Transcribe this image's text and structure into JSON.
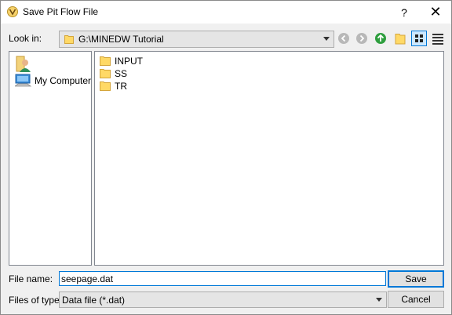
{
  "window": {
    "title": "Save Pit Flow File",
    "help_glyph": "?",
    "close_glyph": "✕"
  },
  "lookin": {
    "label": "Look in:",
    "path": "G:\\MINEDW Tutorial"
  },
  "toolbar": {
    "icons": [
      "back-icon",
      "forward-icon",
      "up-folder-icon",
      "new-folder-icon",
      "list-view-icon",
      "detail-view-icon"
    ]
  },
  "places": {
    "items": [
      {
        "label": "",
        "icon": "user-icon"
      },
      {
        "label": "My Computer",
        "icon": "computer-icon"
      }
    ]
  },
  "files": [
    {
      "name": "INPUT"
    },
    {
      "name": "SS"
    },
    {
      "name": "TR"
    }
  ],
  "filename": {
    "label": "File name:",
    "value": "seepage.dat"
  },
  "filetype": {
    "label": "Files of type:",
    "value": "Data file (*.dat)"
  },
  "buttons": {
    "save": "Save",
    "cancel": "Cancel"
  },
  "colors": {
    "accent": "#0078d7",
    "folder": "#ffd966",
    "green_up": "#2e9e3e"
  }
}
